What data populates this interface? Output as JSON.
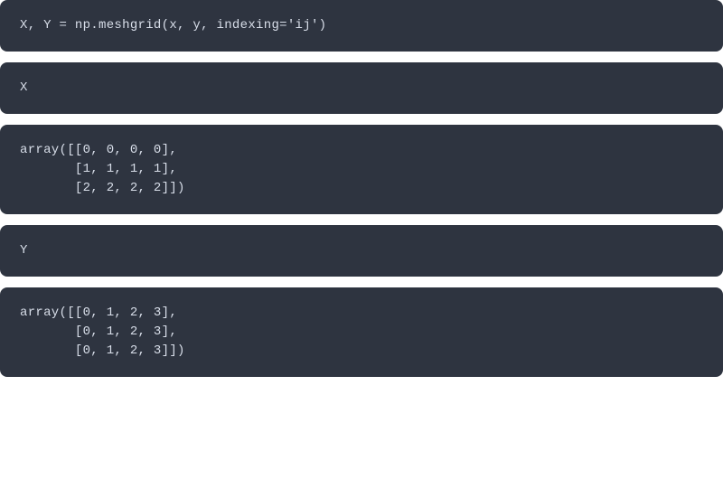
{
  "cells": {
    "cell1_code": "X, Y = np.meshgrid(x, y, indexing='ij')",
    "cell2_code": "X",
    "cell2_output": "array([[0, 0, 0, 0],\n       [1, 1, 1, 1],\n       [2, 2, 2, 2]])",
    "cell3_code": "Y",
    "cell3_output": "array([[0, 1, 2, 3],\n       [0, 1, 2, 3],\n       [0, 1, 2, 3]])"
  }
}
